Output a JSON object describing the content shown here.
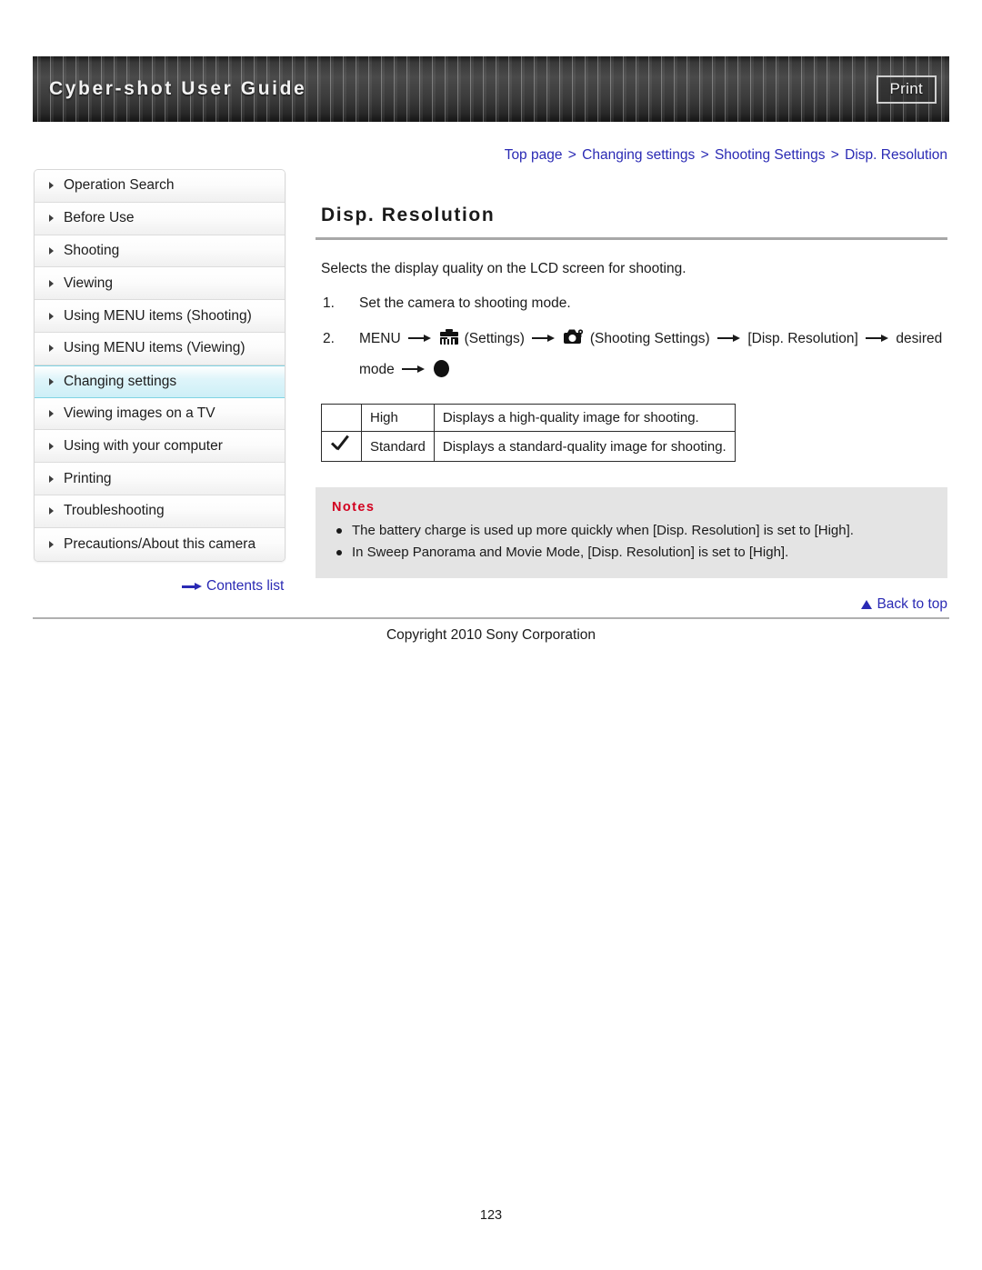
{
  "header": {
    "title": "Cyber-shot User Guide",
    "print_label": "Print"
  },
  "breadcrumb": {
    "items": [
      "Top page",
      "Changing settings",
      "Shooting Settings",
      "Disp. Resolution"
    ],
    "separator": ">"
  },
  "sidebar": {
    "items": [
      {
        "label": "Operation Search",
        "active": false
      },
      {
        "label": "Before Use",
        "active": false
      },
      {
        "label": "Shooting",
        "active": false
      },
      {
        "label": "Viewing",
        "active": false
      },
      {
        "label": "Using MENU items (Shooting)",
        "active": false
      },
      {
        "label": "Using MENU items (Viewing)",
        "active": false
      },
      {
        "label": "Changing settings",
        "active": true
      },
      {
        "label": "Viewing images on a TV",
        "active": false
      },
      {
        "label": "Using with your computer",
        "active": false
      },
      {
        "label": "Printing",
        "active": false
      },
      {
        "label": "Troubleshooting",
        "active": false
      },
      {
        "label": "Precautions/About this camera",
        "active": false
      }
    ],
    "contents_list_label": "Contents list"
  },
  "main": {
    "title": "Disp. Resolution",
    "intro": "Selects the display quality on the LCD screen for shooting.",
    "steps": [
      {
        "number": "1.",
        "text": "Set the camera to shooting mode."
      },
      {
        "number": "2.",
        "part1": "MENU",
        "settings_label": "(Settings)",
        "shooting_settings_label": "(Shooting Settings)",
        "item_label": "[Disp. Resolution]",
        "desired_label": "desired",
        "mode_label": "mode"
      }
    ],
    "options_table": {
      "rows": [
        {
          "checked": false,
          "name": "High",
          "description": "Displays a high-quality image for shooting."
        },
        {
          "checked": true,
          "name": "Standard",
          "description": "Displays a standard-quality image for shooting."
        }
      ]
    },
    "notes": {
      "title": "Notes",
      "items": [
        "The battery charge is used up more quickly when [Disp. Resolution] is set to [High].",
        "In Sweep Panorama and Movie Mode, [Disp. Resolution] is set to [High]."
      ]
    }
  },
  "footer": {
    "back_to_top_label": "Back to top",
    "copyright": "Copyright 2010 Sony Corporation",
    "page_number": "123"
  },
  "colors": {
    "link": "#2a2ab4",
    "notes_title": "#d2001f",
    "active_nav": "#cdeff7",
    "header_bg": "#2b2b2b"
  }
}
